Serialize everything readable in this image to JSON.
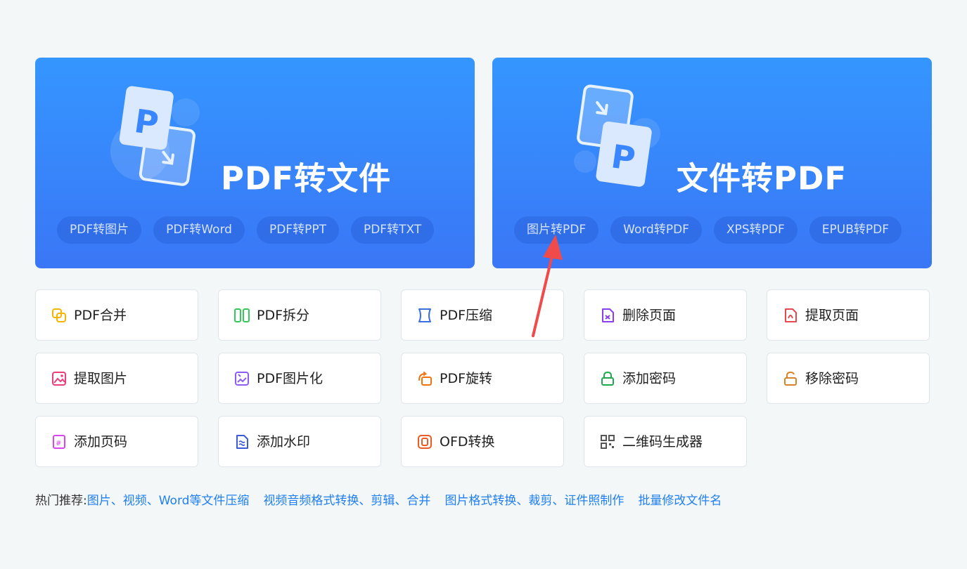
{
  "hero_left": {
    "title": "PDF转文件",
    "chips": [
      "PDF转图片",
      "PDF转Word",
      "PDF转PPT",
      "PDF转TXT"
    ]
  },
  "hero_right": {
    "title": "文件转PDF",
    "chips": [
      "图片转PDF",
      "Word转PDF",
      "XPS转PDF",
      "EPUB转PDF"
    ]
  },
  "tools": [
    {
      "label": "PDF合并",
      "icon": "merge-icon",
      "color": "#f5b400"
    },
    {
      "label": "PDF拆分",
      "icon": "split-icon",
      "color": "#34c759"
    },
    {
      "label": "PDF压缩",
      "icon": "compress-icon",
      "color": "#3b6fe0"
    },
    {
      "label": "删除页面",
      "icon": "delete-page-icon",
      "color": "#8a3ff0"
    },
    {
      "label": "提取页面",
      "icon": "extract-page-icon",
      "color": "#e5484d"
    },
    {
      "label": "提取图片",
      "icon": "extract-image-icon",
      "color": "#ec3e7a"
    },
    {
      "label": "PDF图片化",
      "icon": "pdf-to-image-icon",
      "color": "#8b5cf6"
    },
    {
      "label": "PDF旋转",
      "icon": "rotate-icon",
      "color": "#f0730b"
    },
    {
      "label": "添加密码",
      "icon": "lock-icon",
      "color": "#22a652"
    },
    {
      "label": "移除密码",
      "icon": "unlock-icon",
      "color": "#d9822b"
    },
    {
      "label": "添加页码",
      "icon": "page-number-icon",
      "color": "#d946ef"
    },
    {
      "label": "添加水印",
      "icon": "watermark-icon",
      "color": "#3b5bdb"
    },
    {
      "label": "OFD转换",
      "icon": "ofd-icon",
      "color": "#ee5a24"
    },
    {
      "label": "二维码生成器",
      "icon": "qr-code-icon",
      "color": "#555555"
    }
  ],
  "hot": {
    "label": "热门推荐:",
    "links": [
      "图片、视频、Word等文件压缩",
      "视频音频格式转换、剪辑、合并",
      "图片格式转换、裁剪、证件照制作",
      "批量修改文件名"
    ]
  },
  "colors": {
    "accent": "#3596ff",
    "link": "#1f7ff0",
    "annotation_arrow": "#f04a4a"
  }
}
